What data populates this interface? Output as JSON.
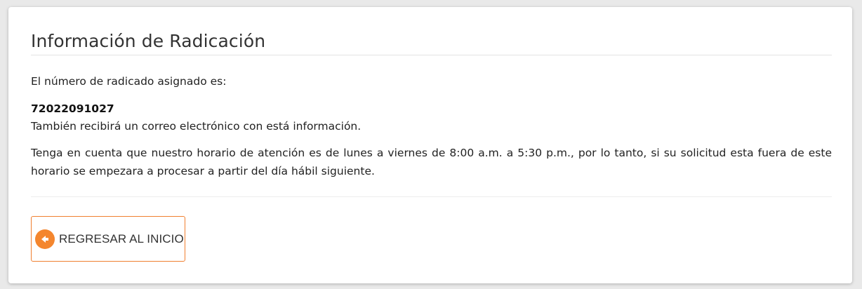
{
  "panel": {
    "title": "Información de Radicación",
    "intro_text": "El número de radicado asignado es:",
    "radicado_number": "72022091027",
    "email_notice": "También recibirá un correo electrónico con está información.",
    "schedule_notice": "Tenga en cuenta que nuestro horario de atención es de lunes a viernes de 8:00 a.m. a 5:30 p.m., por lo tanto, si su solicitud esta fuera de este horario se empezara a procesar a partir del día hábil siguiente."
  },
  "actions": {
    "back_label": "REGRESAR AL INICIO",
    "back_icon": "arrow-left-circle-icon"
  },
  "colors": {
    "accent": "#f4862e",
    "button_border": "#f07f2f",
    "background": "#e9e9e9",
    "card": "#ffffff"
  }
}
